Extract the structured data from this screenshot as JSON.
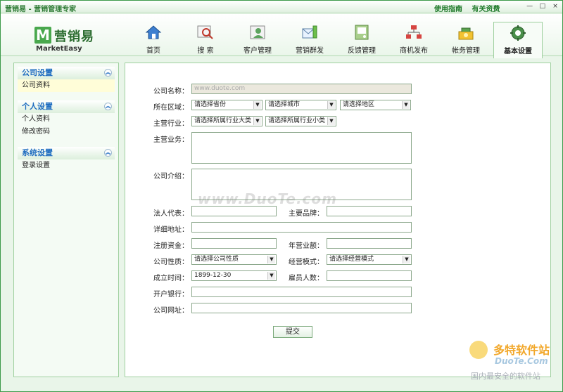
{
  "window": {
    "title": "营销易 - 营销管理专家",
    "links": [
      "使用指南",
      "有关资费"
    ],
    "controls": [
      "—",
      "□",
      "×"
    ]
  },
  "logo": {
    "cn": "营销易",
    "en": "MarketEasy",
    "mark": "M"
  },
  "nav": [
    {
      "label": "首页",
      "icon": "home-icon"
    },
    {
      "label": "搜  索",
      "icon": "search-icon"
    },
    {
      "label": "客户管理",
      "icon": "customer-icon"
    },
    {
      "label": "营销群发",
      "icon": "mail-broadcast-icon"
    },
    {
      "label": "反馈管理",
      "icon": "feedback-icon"
    },
    {
      "label": "商机发布",
      "icon": "org-chart-icon"
    },
    {
      "label": "帐务管理",
      "icon": "account-icon"
    },
    {
      "label": "基本设置",
      "icon": "gear-icon",
      "active": true
    }
  ],
  "sidebar": [
    {
      "title": "公司设置",
      "items": [
        "公司资料"
      ]
    },
    {
      "title": "个人设置",
      "items": [
        "个人资料",
        "修改密码"
      ]
    },
    {
      "title": "系统设置",
      "items": [
        "登录设置"
      ]
    }
  ],
  "form": {
    "company_name_label": "公司名称：",
    "company_name_value": "www.duote.com",
    "region_label": "所在区域：",
    "province": "请选择省份",
    "city": "请选择城市",
    "district": "请选择地区",
    "industry_label": "主营行业：",
    "industry_major": "请选择所属行业大类",
    "industry_minor": "请选择所属行业小类",
    "business_label": "主营业务：",
    "intro_label": "公司介绍：",
    "legal_rep_label": "法人代表：",
    "brand_label": "主要品牌：",
    "address_label": "详细地址：",
    "capital_label": "注册资金：",
    "revenue_label": "年营业额：",
    "nature_label": "公司性质：",
    "nature_value": "请选择公司性质",
    "mode_label": "经营模式：",
    "mode_value": "请选择经营模式",
    "founded_label": "成立时间：",
    "founded_value": "1899-12-30",
    "employees_label": "雇员人数：",
    "bank_label": "开户银行：",
    "website_label": "公司网址：",
    "submit": "提交"
  },
  "watermark": {
    "center": "www.DuoTe.com",
    "corner_cn": "多特软件站",
    "corner_en": "DuoTe.Com",
    "corner_tag": "国内最安全的软件站"
  }
}
